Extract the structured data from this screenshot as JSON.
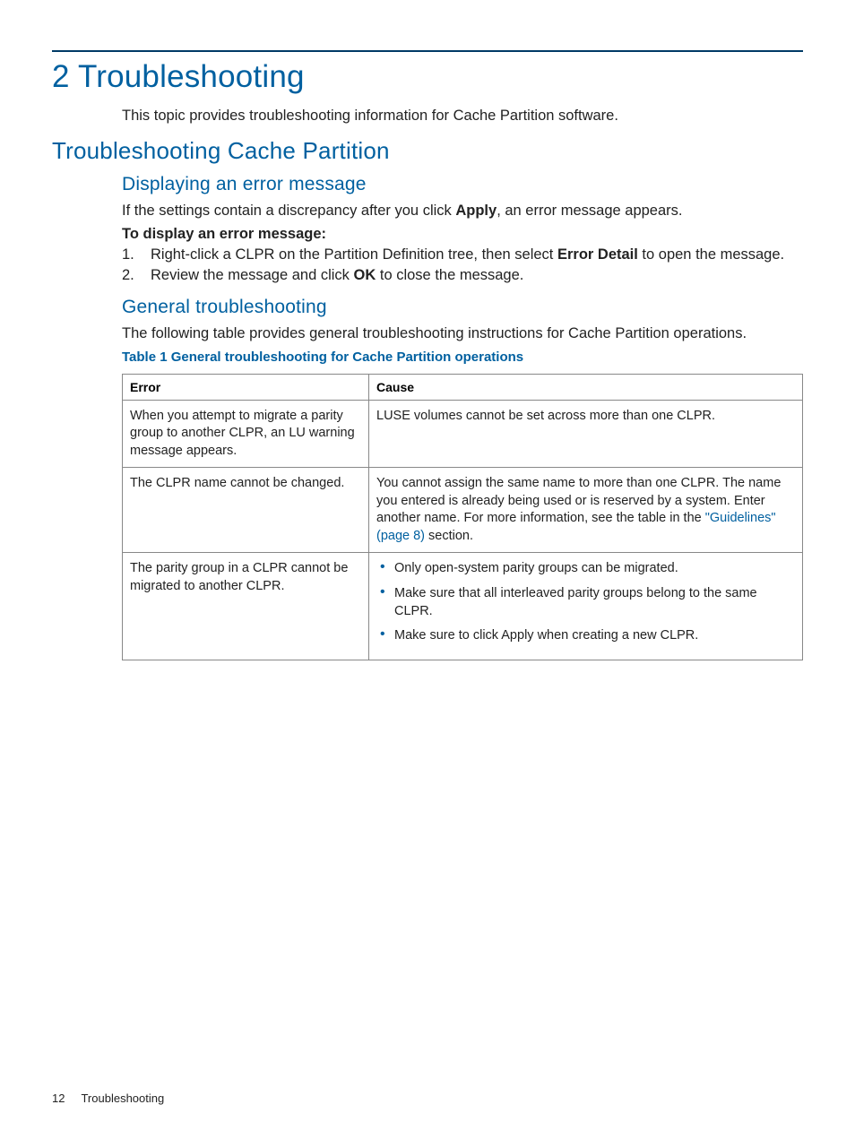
{
  "heading1": "2 Troubleshooting",
  "intro": "This topic provides troubleshooting information for Cache Partition software.",
  "heading2": "Troubleshooting Cache Partition",
  "sec1": {
    "heading3": "Displaying an error message",
    "para_pre": "If the settings contain a discrepancy after you click ",
    "para_bold": "Apply",
    "para_post": ", an error message appears.",
    "lead_label": "To display an error message:",
    "step1_num": "1.",
    "step1_pre": "Right-click a CLPR on the Partition Definition tree, then select ",
    "step1_bold": "Error Detail",
    "step1_post": " to open the message.",
    "step2_num": "2.",
    "step2_pre": "Review the message and click ",
    "step2_bold": "OK",
    "step2_post": " to close the message."
  },
  "sec2": {
    "heading3": "General troubleshooting",
    "para": "The following table provides general troubleshooting instructions for Cache Partition operations.",
    "table_caption": "Table 1 General troubleshooting for Cache Partition operations",
    "th_error": "Error",
    "th_cause": "Cause",
    "row1": {
      "error": "When you attempt to migrate a parity group to another CLPR, an LU warning message appears.",
      "cause": "LUSE volumes cannot be set across more than one CLPR."
    },
    "row2": {
      "error": "The CLPR name cannot be changed.",
      "cause_pre": "You cannot assign the same name to more than one CLPR. The name you entered is already being used or is reserved by a system. Enter another name. For more information, see the table in the ",
      "cause_link": "\"Guidelines\" (page 8)",
      "cause_post": " section."
    },
    "row3": {
      "error": "The parity group in a CLPR cannot be migrated to another CLPR.",
      "b1": "Only open-system parity groups can be migrated.",
      "b2": "Make sure that all interleaved parity groups belong to the same CLPR.",
      "b3": "Make sure to click Apply when creating a new CLPR."
    }
  },
  "footer": {
    "page": "12",
    "chapter": "Troubleshooting"
  }
}
